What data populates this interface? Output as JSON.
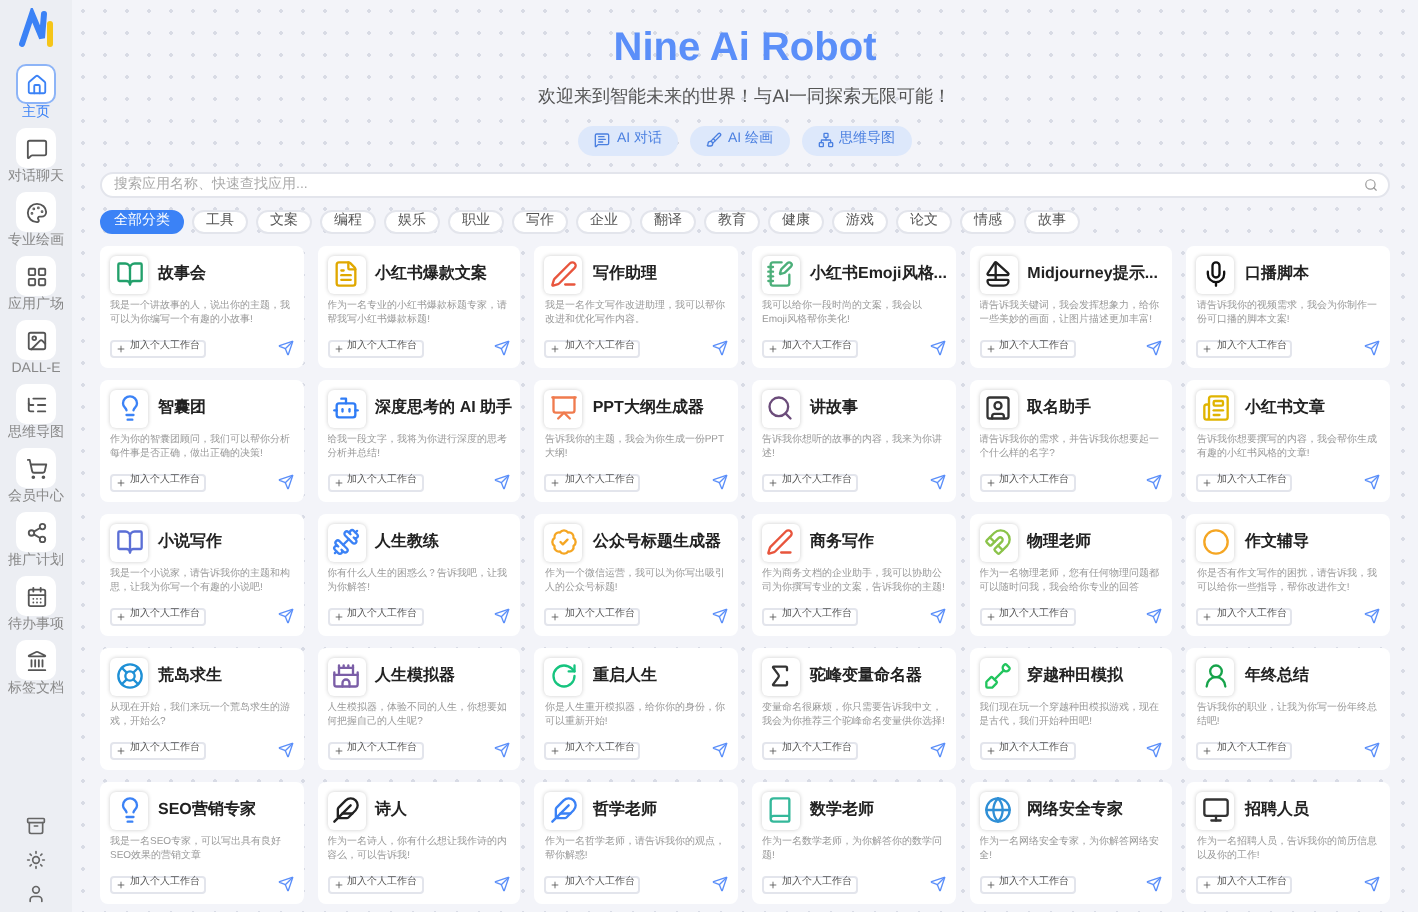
{
  "sidebar": {
    "items": [
      {
        "label": "主页",
        "selected": true
      },
      {
        "label": "对话聊天",
        "selected": false
      },
      {
        "label": "专业绘画",
        "selected": false
      },
      {
        "label": "应用广场",
        "selected": false
      },
      {
        "label": "DALL-E",
        "selected": false
      },
      {
        "label": "思维导图",
        "selected": false
      },
      {
        "label": "会员中心",
        "selected": false
      },
      {
        "label": "推广计划",
        "selected": false
      },
      {
        "label": "待办事项",
        "selected": false
      },
      {
        "label": "标签文档",
        "selected": false
      }
    ]
  },
  "header": {
    "title": "Nine Ai Robot",
    "subtitle": "欢迎来到智能未来的世界！与AI一同探索无限可能！",
    "buttons": [
      "AI 对话",
      "AI 绘画",
      "思维导图"
    ]
  },
  "search": {
    "placeholder": "搜索应用名称、快速查找应用..."
  },
  "categories": [
    {
      "label": "全部分类",
      "selected": true
    },
    {
      "label": "工具",
      "selected": false
    },
    {
      "label": "文案",
      "selected": false
    },
    {
      "label": "编程",
      "selected": false
    },
    {
      "label": "娱乐",
      "selected": false
    },
    {
      "label": "职业",
      "selected": false
    },
    {
      "label": "写作",
      "selected": false
    },
    {
      "label": "企业",
      "selected": false
    },
    {
      "label": "翻译",
      "selected": false
    },
    {
      "label": "教育",
      "selected": false
    },
    {
      "label": "健康",
      "selected": false
    },
    {
      "label": "游戏",
      "selected": false
    },
    {
      "label": "论文",
      "selected": false
    },
    {
      "label": "情感",
      "selected": false
    },
    {
      "label": "故事",
      "selected": false
    }
  ],
  "apps": [
    {
      "title": "故事会",
      "description": "我是一个讲故事的人，说出你的主题，我可以为你编写一个有趣的小故事!",
      "add_label": "加入个人工作台"
    },
    {
      "title": "小红书爆款文案",
      "description": "作为一名专业的小红书爆款标题专家，请帮我写小红书爆款标题!",
      "add_label": "加入个人工作台"
    },
    {
      "title": "写作助理",
      "description": "我是一名作文写作改进助理，我可以帮你改进和优化写作内容。",
      "add_label": "加入个人工作台"
    },
    {
      "title": "小红书Emoji风格...",
      "description": "我可以给你一段时尚的文案，我会以Emoji风格帮你美化!",
      "add_label": "加入个人工作台"
    },
    {
      "title": "Midjourney提示...",
      "description": "请告诉我关键词，我会发挥想象力，给你一些美妙的画面，让图片描述更加丰富!",
      "add_label": "加入个人工作台"
    },
    {
      "title": "口播脚本",
      "description": "请告诉我你的视频需求，我会为你制作一份可口播的脚本文案!",
      "add_label": "加入个人工作台"
    },
    {
      "title": "智囊团",
      "description": "作为你的智囊团顾问，我们可以帮你分析每件事是否正确，做出正确的决策!",
      "add_label": "加入个人工作台"
    },
    {
      "title": "深度思考的 AI 助手",
      "description": "给我一段文字，我将为你进行深度的思考分析并总结!",
      "add_label": "加入个人工作台"
    },
    {
      "title": "PPT大纲生成器",
      "description": "告诉我你的主题，我会为你生成一份PPT大纲!",
      "add_label": "加入个人工作台"
    },
    {
      "title": "讲故事",
      "description": "告诉我你想听的故事的内容，我来为你讲述!",
      "add_label": "加入个人工作台"
    },
    {
      "title": "取名助手",
      "description": "请告诉我你的需求，并告诉我你想要起一个什么样的名字?",
      "add_label": "加入个人工作台"
    },
    {
      "title": "小红书文章",
      "description": "告诉我你想要撰写的内容，我会帮你生成有趣的小红书风格的文章!",
      "add_label": "加入个人工作台"
    },
    {
      "title": "小说写作",
      "description": "我是一个小说家，请告诉我你的主题和构思，让我为你写一个有趣的小说吧!",
      "add_label": "加入个人工作台"
    },
    {
      "title": "人生教练",
      "description": "你有什么人生的困惑么？告诉我吧，让我为你解答!",
      "add_label": "加入个人工作台"
    },
    {
      "title": "公众号标题生成器",
      "description": "作为一个微信运营，我可以为你写出吸引人的公众号标题!",
      "add_label": "加入个人工作台"
    },
    {
      "title": "商务写作",
      "description": "作为商务文档的企业助手，我可以协助公司为你撰写专业的文案，告诉我你的主题!",
      "add_label": "加入个人工作台"
    },
    {
      "title": "物理老师",
      "description": "作为一名物理老师，您有任何物理问题都可以随时问我，我会给你专业的回答",
      "add_label": "加入个人工作台"
    },
    {
      "title": "作文辅导",
      "description": "你是否有作文写作的困扰，请告诉我，我可以给你一些指导，帮你改进作文!",
      "add_label": "加入个人工作台"
    },
    {
      "title": "荒岛求生",
      "description": "从现在开始，我们来玩一个荒岛求生的游戏，开始么?",
      "add_label": "加入个人工作台"
    },
    {
      "title": "人生模拟器",
      "description": "人生模拟器，体验不同的人生，你想要如何把握自己的人生呢?",
      "add_label": "加入个人工作台"
    },
    {
      "title": "重启人生",
      "description": "你是人生重开模拟器，给你你的身份，你可以重新开始!",
      "add_label": "加入个人工作台"
    },
    {
      "title": "驼峰变量命名器",
      "description": "变量命名很麻烦，你只需要告诉我中文，我会为你推荐三个驼峰命名变量供你选择!",
      "add_label": "加入个人工作台"
    },
    {
      "title": "穿越种田模拟",
      "description": "我们现在玩一个穿越种田模拟游戏，现在是古代，我们开始种田吧!",
      "add_label": "加入个人工作台"
    },
    {
      "title": "年终总结",
      "description": "告诉我你的职业，让我为你写一份年终总结吧!",
      "add_label": "加入个人工作台"
    },
    {
      "title": "SEO营销专家",
      "description": "我是一名SEO专家，可以写出具有良好SEO效果的营销文章",
      "add_label": "加入个人工作台"
    },
    {
      "title": "诗人",
      "description": "作为一名诗人，你有什么想让我作诗的内容么，可以告诉我!",
      "add_label": "加入个人工作台"
    },
    {
      "title": "哲学老师",
      "description": "作为一名哲学老师，请告诉我你的观点，帮你解惑!",
      "add_label": "加入个人工作台"
    },
    {
      "title": "数学老师",
      "description": "作为一名数学老师，为你解答你的数学问题!",
      "add_label": "加入个人工作台"
    },
    {
      "title": "网络安全专家",
      "description": "作为一名网络安全专家，为你解答网络安全!",
      "add_label": "加入个人工作台"
    },
    {
      "title": "招聘人员",
      "description": "作为一名招聘人员，告诉我你的简历信息以及你的工作!",
      "add_label": "加入个人工作台"
    }
  ]
}
